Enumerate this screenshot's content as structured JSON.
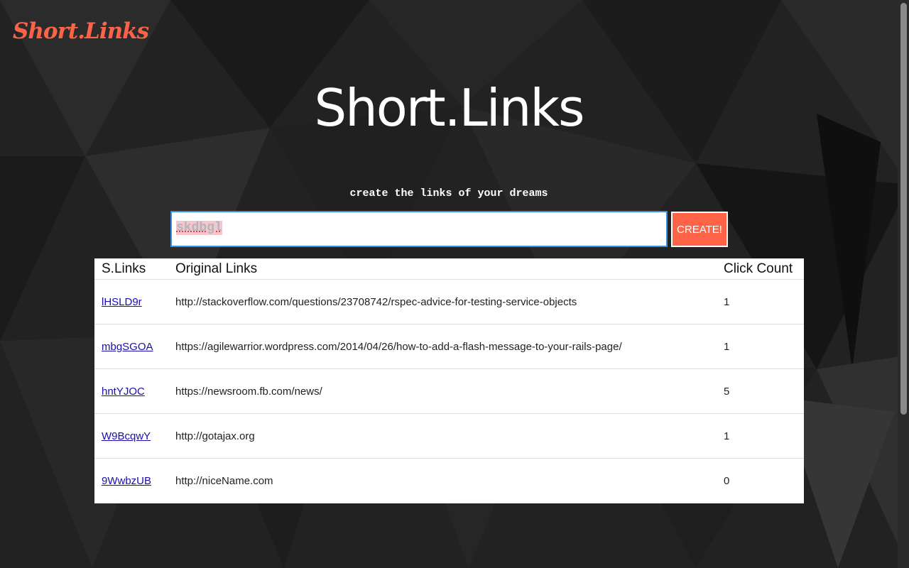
{
  "brand": {
    "logo_text": "Short.Links",
    "title": "Short.Links",
    "tagline": "create the links of your dreams"
  },
  "form": {
    "input_value": "skdbgl",
    "create_label": "CREATE!"
  },
  "table": {
    "headers": [
      "S.Links",
      "Original Links",
      "Click Count"
    ],
    "rows": [
      {
        "short": "lHSLD9r",
        "original": "http://stackoverflow.com/questions/23708742/rspec-advice-for-testing-service-objects",
        "clicks": "1"
      },
      {
        "short": "mbgSGOA",
        "original": "https://agilewarrior.wordpress.com/2014/04/26/how-to-add-a-flash-message-to-your-rails-page/",
        "clicks": "1"
      },
      {
        "short": "hntYJOC",
        "original": "https://newsroom.fb.com/news/",
        "clicks": "5"
      },
      {
        "short": "W9BcqwY",
        "original": "http://gotajax.org",
        "clicks": "1"
      },
      {
        "short": "9WwbzUB",
        "original": "http://niceName.com",
        "clicks": "0"
      }
    ]
  },
  "colors": {
    "accent": "#ff6347",
    "background": "#1f1f1f",
    "link": "#1a0dab",
    "input_border": "#3b8de0"
  }
}
